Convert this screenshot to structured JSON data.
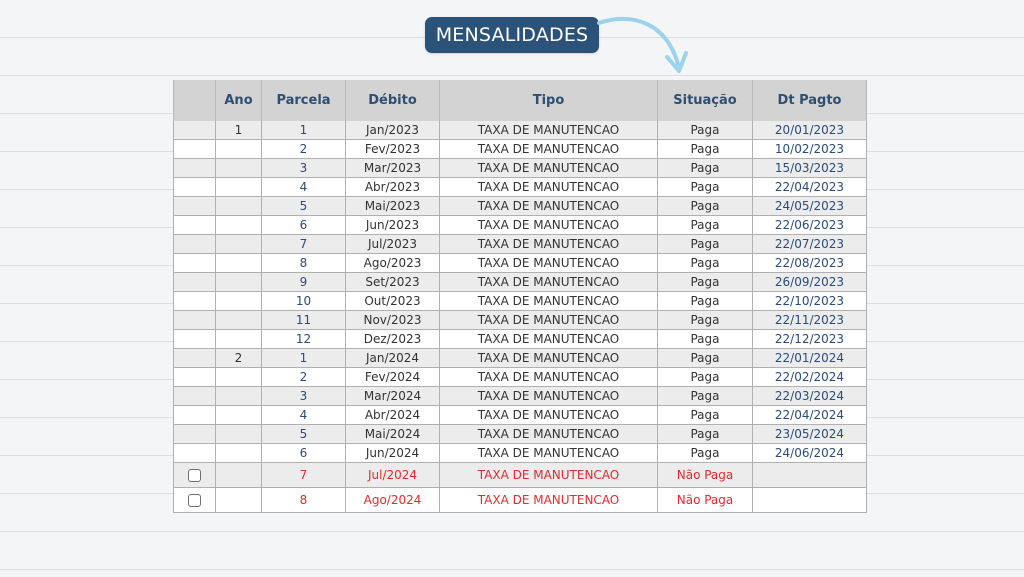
{
  "title": "MENSALIDADES",
  "headers": [
    "",
    "Ano",
    "Parcela",
    "Débito",
    "Tipo",
    "Situação",
    "Dt Pagto"
  ],
  "rows": [
    {
      "ano": "1",
      "parcela": "1",
      "debito": "Jan/2023",
      "tipo": "TAXA DE MANUTENCAO",
      "situacao": "Paga",
      "dt": "20/01/2023"
    },
    {
      "ano": "",
      "parcela": "2",
      "debito": "Fev/2023",
      "tipo": "TAXA DE MANUTENCAO",
      "situacao": "Paga",
      "dt": "10/02/2023"
    },
    {
      "ano": "",
      "parcela": "3",
      "debito": "Mar/2023",
      "tipo": "TAXA DE MANUTENCAO",
      "situacao": "Paga",
      "dt": "15/03/2023"
    },
    {
      "ano": "",
      "parcela": "4",
      "debito": "Abr/2023",
      "tipo": "TAXA DE MANUTENCAO",
      "situacao": "Paga",
      "dt": "22/04/2023"
    },
    {
      "ano": "",
      "parcela": "5",
      "debito": "Mai/2023",
      "tipo": "TAXA DE MANUTENCAO",
      "situacao": "Paga",
      "dt": "24/05/2023"
    },
    {
      "ano": "",
      "parcela": "6",
      "debito": "Jun/2023",
      "tipo": "TAXA DE MANUTENCAO",
      "situacao": "Paga",
      "dt": "22/06/2023"
    },
    {
      "ano": "",
      "parcela": "7",
      "debito": "Jul/2023",
      "tipo": "TAXA DE MANUTENCAO",
      "situacao": "Paga",
      "dt": "22/07/2023"
    },
    {
      "ano": "",
      "parcela": "8",
      "debito": "Ago/2023",
      "tipo": "TAXA DE MANUTENCAO",
      "situacao": "Paga",
      "dt": "22/08/2023"
    },
    {
      "ano": "",
      "parcela": "9",
      "debito": "Set/2023",
      "tipo": "TAXA DE MANUTENCAO",
      "situacao": "Paga",
      "dt": "26/09/2023"
    },
    {
      "ano": "",
      "parcela": "10",
      "debito": "Out/2023",
      "tipo": "TAXA DE MANUTENCAO",
      "situacao": "Paga",
      "dt": "22/10/2023"
    },
    {
      "ano": "",
      "parcela": "11",
      "debito": "Nov/2023",
      "tipo": "TAXA DE MANUTENCAO",
      "situacao": "Paga",
      "dt": "22/11/2023"
    },
    {
      "ano": "",
      "parcela": "12",
      "debito": "Dez/2023",
      "tipo": "TAXA DE MANUTENCAO",
      "situacao": "Paga",
      "dt": "22/12/2023"
    },
    {
      "ano": "2",
      "parcela": "1",
      "debito": "Jan/2024",
      "tipo": "TAXA DE MANUTENCAO",
      "situacao": "Paga",
      "dt": "22/01/2024"
    },
    {
      "ano": "",
      "parcela": "2",
      "debito": "Fev/2024",
      "tipo": "TAXA DE MANUTENCAO",
      "situacao": "Paga",
      "dt": "22/02/2024"
    },
    {
      "ano": "",
      "parcela": "3",
      "debito": "Mar/2024",
      "tipo": "TAXA DE MANUTENCAO",
      "situacao": "Paga",
      "dt": "22/03/2024"
    },
    {
      "ano": "",
      "parcela": "4",
      "debito": "Abr/2024",
      "tipo": "TAXA DE MANUTENCAO",
      "situacao": "Paga",
      "dt": "22/04/2024"
    },
    {
      "ano": "",
      "parcela": "5",
      "debito": "Mai/2024",
      "tipo": "TAXA DE MANUTENCAO",
      "situacao": "Paga",
      "dt": "23/05/2024"
    },
    {
      "ano": "",
      "parcela": "6",
      "debito": "Jun/2024",
      "tipo": "TAXA DE MANUTENCAO",
      "situacao": "Paga",
      "dt": "24/06/2024"
    },
    {
      "ano": "",
      "parcela": "7",
      "debito": "Jul/2024",
      "tipo": "TAXA DE MANUTENCAO",
      "situacao": "Não Paga",
      "dt": "",
      "selectable": true
    },
    {
      "ano": "",
      "parcela": "8",
      "debito": "Ago/2024",
      "tipo": "TAXA DE MANUTENCAO",
      "situacao": "Não Paga",
      "dt": "",
      "selectable": true
    }
  ],
  "colors": {
    "badge": "#2b5278",
    "header_bg": "#d3d3d3",
    "header_text": "#2e4f72",
    "paid_text": "#2b4b7a",
    "unpaid_text": "#e52b2b",
    "arrow": "#9dd3ea"
  }
}
